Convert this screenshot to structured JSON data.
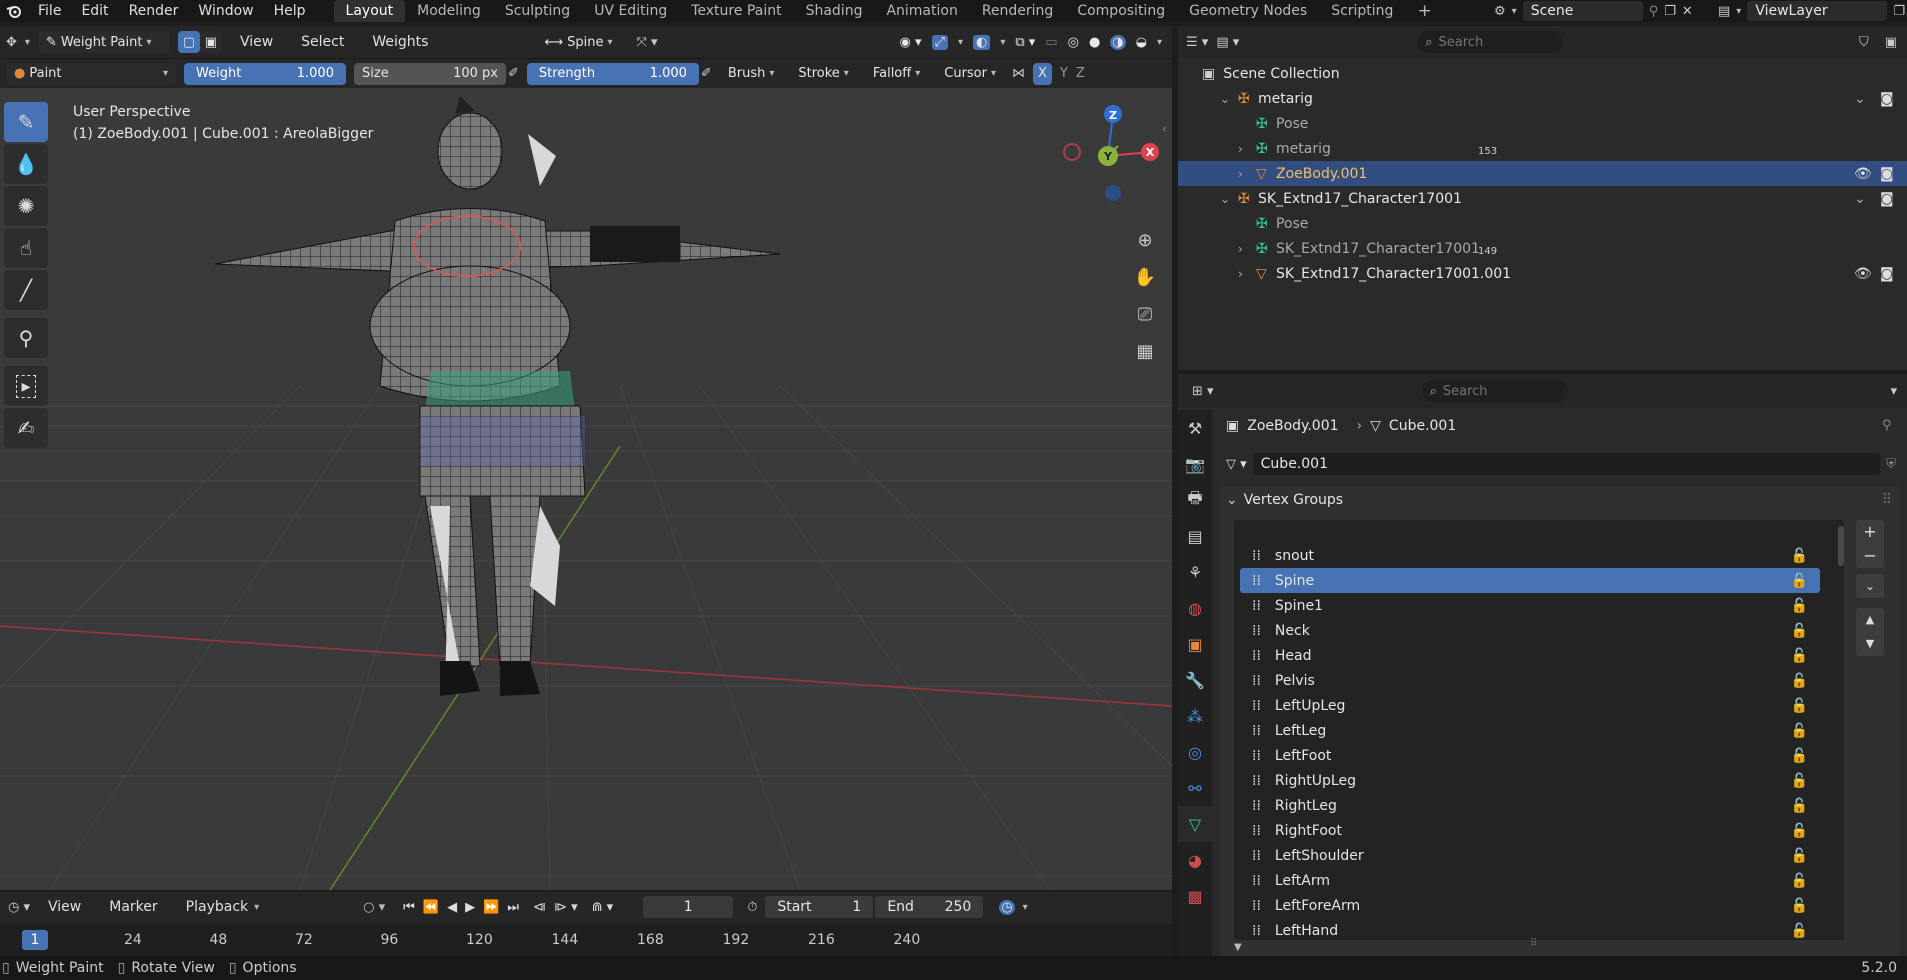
{
  "topbar": {
    "menus": [
      "File",
      "Edit",
      "Render",
      "Window",
      "Help"
    ],
    "workspaces": [
      "Layout",
      "Modeling",
      "Sculpting",
      "UV Editing",
      "Texture Paint",
      "Shading",
      "Animation",
      "Rendering",
      "Compositing",
      "Geometry Nodes",
      "Scripting"
    ],
    "active_workspace": "Layout",
    "add_tab": "+",
    "scene": "Scene",
    "view_layer": "ViewLayer"
  },
  "viewport_header": {
    "mode": "Weight Paint",
    "menus": [
      "View",
      "Select",
      "Weights"
    ],
    "bone": "Spine"
  },
  "tool_header": {
    "tool": "Paint",
    "weight_label": "Weight",
    "weight_value": "1.000",
    "size_label": "Size",
    "size_value": "100 px",
    "strength_label": "Strength",
    "strength_value": "1.000",
    "dropdowns": [
      "Brush",
      "Stroke",
      "Falloff",
      "Cursor"
    ],
    "axes": [
      "X",
      "Y",
      "Z"
    ]
  },
  "viewport": {
    "perspective": "User Perspective",
    "object_info": "(1) ZoeBody.001 | Cube.001 : AreolaBigger",
    "gizmo": {
      "z": "Z",
      "y": "Y",
      "x": "X"
    }
  },
  "outliner": {
    "search_placeholder": "Search",
    "root": "Scene Collection",
    "rows": [
      {
        "label": "metarig",
        "indent": 1,
        "type": "armature"
      },
      {
        "label": "Pose",
        "indent": 2,
        "type": "pose"
      },
      {
        "label": "metarig",
        "indent": 2,
        "type": "armdata",
        "badge": "153"
      },
      {
        "label": "ZoeBody.001",
        "indent": 2,
        "type": "mesh",
        "selected": true
      },
      {
        "label": "SK_Extnd17_Character17001",
        "indent": 1,
        "type": "armature"
      },
      {
        "label": "Pose",
        "indent": 2,
        "type": "pose"
      },
      {
        "label": "SK_Extnd17_Character17001",
        "indent": 2,
        "type": "armdata",
        "badge": "149"
      },
      {
        "label": "SK_Extnd17_Character17001.001",
        "indent": 2,
        "type": "mesh"
      }
    ]
  },
  "properties": {
    "search_placeholder": "Search",
    "breadcrumb_object": "ZoeBody.001",
    "breadcrumb_data": "Cube.001",
    "data_name": "Cube.001",
    "panel_title": "Vertex Groups",
    "vertex_groups": [
      "snout",
      "Spine",
      "Spine1",
      "Neck",
      "Head",
      "Pelvis",
      "LeftUpLeg",
      "LeftLeg",
      "LeftFoot",
      "RightUpLeg",
      "RightLeg",
      "RightFoot",
      "LeftShoulder",
      "LeftArm",
      "LeftForeArm",
      "LeftHand"
    ],
    "selected_group": "Spine"
  },
  "timeline": {
    "menus": [
      "View",
      "Marker",
      "Playback"
    ],
    "current_frame": "1",
    "start_label": "Start",
    "start_value": "1",
    "end_label": "End",
    "end_value": "250",
    "ruler": [
      "1",
      "24",
      "48",
      "72",
      "96",
      "120",
      "144",
      "168",
      "192",
      "216",
      "240"
    ]
  },
  "statusbar": {
    "items": [
      "Weight Paint",
      "Rotate View",
      "Options"
    ],
    "version": "5.2.0"
  },
  "colors": {
    "accent": "#4772b3",
    "outliner_selection": "#334d80",
    "x_axis": "#e0414f",
    "y_axis": "#8ab33b",
    "z_axis": "#2f6fd4",
    "mesh_icon": "#2ec4a0",
    "object_icon": "#e0893a"
  }
}
